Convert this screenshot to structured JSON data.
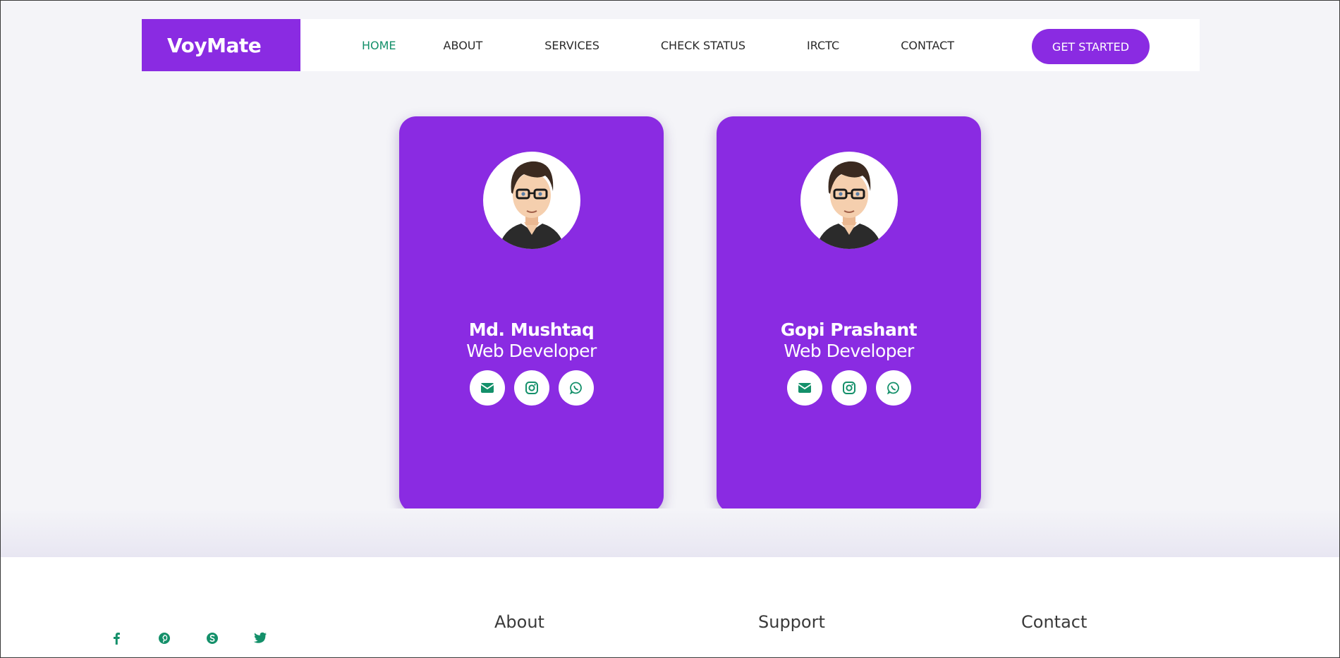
{
  "nav": {
    "brand": "VoyMate",
    "links": [
      "HOME",
      "ABOUT",
      "SERVICES",
      "CHECK STATUS",
      "IRCTC",
      "CONTACT"
    ],
    "active": "HOME",
    "cta_label": "GET STARTED"
  },
  "cards": [
    {
      "name": "Md. Mushtaq",
      "role": "Web Developer",
      "socials": [
        "envelope-icon",
        "instagram-icon",
        "whatsapp-icon"
      ]
    },
    {
      "name": "Gopi Prashant",
      "role": "Web Developer",
      "socials": [
        "envelope-icon",
        "instagram-icon",
        "whatsapp-icon"
      ]
    }
  ],
  "footer": {
    "socials": [
      "facebook-icon",
      "pinterest-icon",
      "skype-icon",
      "twitter-icon"
    ],
    "headings": [
      "About",
      "Support",
      "Contact"
    ]
  },
  "colors": {
    "accent": "#8a2be2",
    "active_link": "#14906a",
    "icon": "#14906a"
  }
}
